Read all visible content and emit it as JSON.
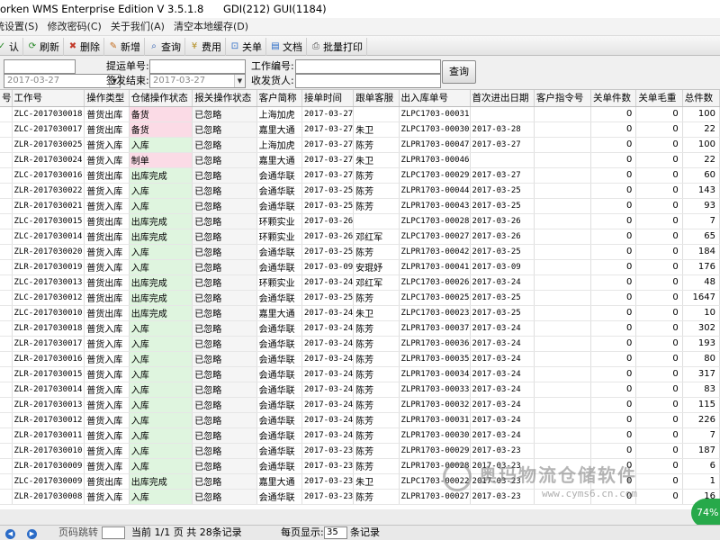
{
  "title": {
    "app": "orken WMS Enterprise Edition V 3.5.1.8",
    "gdi": "GDI(212) GUI(1184)"
  },
  "menu": [
    "统设置(S)",
    "修改密码(C)",
    "关于我们(A)",
    "清空本地缓存(D)"
  ],
  "toolbar": [
    {
      "label": "认",
      "icon": "check-icon"
    },
    {
      "label": "刷新",
      "icon": "refresh-icon"
    },
    {
      "label": "删除",
      "icon": "delete-icon"
    },
    {
      "label": "新增",
      "icon": "edit-icon"
    },
    {
      "label": "查询",
      "icon": "search-icon"
    },
    {
      "label": "费用",
      "icon": "money-icon"
    },
    {
      "label": "关单",
      "icon": "close-order-icon"
    },
    {
      "label": "文档",
      "icon": "document-icon"
    },
    {
      "label": "批量打印",
      "icon": "print-icon"
    }
  ],
  "filters": {
    "tracking_no_label": "提运单号:",
    "sign_end_label": "签发结束:",
    "work_no_label": "工作编号:",
    "consignee_label": "收发货人:",
    "start_date": "2017-03-27",
    "end_date": "2017-03-27",
    "query_button": "查询"
  },
  "columns": [
    "号",
    "工作号",
    "操作类型",
    "仓储操作状态",
    "报关操作状态",
    "客户简称",
    "接单时间",
    "跟单客服",
    "出入库单号",
    "首次进出日期",
    "客户指令号",
    "关单件数",
    "关单毛重",
    "总件数"
  ],
  "rows": [
    [
      "",
      "ZLC-2017030018",
      "普货出库",
      "备货",
      "已忽略",
      "上海加虎",
      "2017-03-27",
      "",
      "ZLPC1703-00031",
      "",
      "",
      "0",
      "0",
      "100"
    ],
    [
      "",
      "ZLC-2017030017",
      "普货出库",
      "备货",
      "已忽略",
      "嘉里大通",
      "2017-03-27",
      "朱卫",
      "ZLPC1703-00030",
      "2017-03-28",
      "",
      "0",
      "0",
      "22"
    ],
    [
      "",
      "ZLR-2017030025",
      "普货入库",
      "入库",
      "已忽略",
      "上海加虎",
      "2017-03-27",
      "陈芳",
      "ZLPR1703-00047",
      "2017-03-27",
      "",
      "0",
      "0",
      "100"
    ],
    [
      "",
      "ZLR-2017030024",
      "普货入库",
      "制单",
      "已忽略",
      "嘉里大通",
      "2017-03-27",
      "朱卫",
      "ZLPR1703-00046",
      "",
      "",
      "0",
      "0",
      "22"
    ],
    [
      "",
      "ZLC-2017030016",
      "普货出库",
      "出库完成",
      "已忽略",
      "会通华联",
      "2017-03-27",
      "陈芳",
      "ZLPC1703-00029",
      "2017-03-27",
      "",
      "0",
      "0",
      "60"
    ],
    [
      "",
      "ZLR-2017030022",
      "普货入库",
      "入库",
      "已忽略",
      "会通华联",
      "2017-03-25",
      "陈芳",
      "ZLPR1703-00044",
      "2017-03-25",
      "",
      "0",
      "0",
      "143"
    ],
    [
      "",
      "ZLR-2017030021",
      "普货入库",
      "入库",
      "已忽略",
      "会通华联",
      "2017-03-25",
      "陈芳",
      "ZLPR1703-00043",
      "2017-03-25",
      "",
      "0",
      "0",
      "93"
    ],
    [
      "",
      "ZLC-2017030015",
      "普货出库",
      "出库完成",
      "已忽略",
      "环颗实业",
      "2017-03-26",
      "",
      "ZLPC1703-00028",
      "2017-03-26",
      "",
      "0",
      "0",
      "7"
    ],
    [
      "",
      "ZLC-2017030014",
      "普货出库",
      "出库完成",
      "已忽略",
      "环颗实业",
      "2017-03-26",
      "邓红军",
      "ZLPC1703-00027",
      "2017-03-26",
      "",
      "0",
      "0",
      "65"
    ],
    [
      "",
      "ZLR-2017030020",
      "普货入库",
      "入库",
      "已忽略",
      "会通华联",
      "2017-03-25",
      "陈芳",
      "ZLPR1703-00042",
      "2017-03-25",
      "",
      "0",
      "0",
      "184"
    ],
    [
      "",
      "ZLR-2017030019",
      "普货入库",
      "入库",
      "已忽略",
      "会通华联",
      "2017-03-09",
      "安琨妤",
      "ZLPR1703-00041",
      "2017-03-09",
      "",
      "0",
      "0",
      "176"
    ],
    [
      "",
      "ZLC-2017030013",
      "普货出库",
      "出库完成",
      "已忽略",
      "环颗实业",
      "2017-03-24",
      "邓红军",
      "ZLPC1703-00026",
      "2017-03-24",
      "",
      "0",
      "0",
      "48"
    ],
    [
      "",
      "ZLC-2017030012",
      "普货出库",
      "出库完成",
      "已忽略",
      "会通华联",
      "2017-03-25",
      "陈芳",
      "ZLPC1703-00025",
      "2017-03-25",
      "",
      "0",
      "0",
      "1647"
    ],
    [
      "",
      "ZLC-2017030010",
      "普货出库",
      "出库完成",
      "已忽略",
      "嘉里大通",
      "2017-03-24",
      "朱卫",
      "ZLPC1703-00023",
      "2017-03-25",
      "",
      "0",
      "0",
      "10"
    ],
    [
      "",
      "ZLR-2017030018",
      "普货入库",
      "入库",
      "已忽略",
      "会通华联",
      "2017-03-24",
      "陈芳",
      "ZLPR1703-00037",
      "2017-03-24",
      "",
      "0",
      "0",
      "302"
    ],
    [
      "",
      "ZLR-2017030017",
      "普货入库",
      "入库",
      "已忽略",
      "会通华联",
      "2017-03-24",
      "陈芳",
      "ZLPR1703-00036",
      "2017-03-24",
      "",
      "0",
      "0",
      "193"
    ],
    [
      "",
      "ZLR-2017030016",
      "普货入库",
      "入库",
      "已忽略",
      "会通华联",
      "2017-03-24",
      "陈芳",
      "ZLPR1703-00035",
      "2017-03-24",
      "",
      "0",
      "0",
      "80"
    ],
    [
      "",
      "ZLR-2017030015",
      "普货入库",
      "入库",
      "已忽略",
      "会通华联",
      "2017-03-24",
      "陈芳",
      "ZLPR1703-00034",
      "2017-03-24",
      "",
      "0",
      "0",
      "317"
    ],
    [
      "",
      "ZLR-2017030014",
      "普货入库",
      "入库",
      "已忽略",
      "会通华联",
      "2017-03-24",
      "陈芳",
      "ZLPR1703-00033",
      "2017-03-24",
      "",
      "0",
      "0",
      "83"
    ],
    [
      "",
      "ZLR-2017030013",
      "普货入库",
      "入库",
      "已忽略",
      "会通华联",
      "2017-03-24",
      "陈芳",
      "ZLPR1703-00032",
      "2017-03-24",
      "",
      "0",
      "0",
      "115"
    ],
    [
      "",
      "ZLR-2017030012",
      "普货入库",
      "入库",
      "已忽略",
      "会通华联",
      "2017-03-24",
      "陈芳",
      "ZLPR1703-00031",
      "2017-03-24",
      "",
      "0",
      "0",
      "226"
    ],
    [
      "",
      "ZLR-2017030011",
      "普货入库",
      "入库",
      "已忽略",
      "会通华联",
      "2017-03-24",
      "陈芳",
      "ZLPR1703-00030",
      "2017-03-24",
      "",
      "0",
      "0",
      "7"
    ],
    [
      "",
      "ZLR-2017030010",
      "普货入库",
      "入库",
      "已忽略",
      "会通华联",
      "2017-03-23",
      "陈芳",
      "ZLPR1703-00029",
      "2017-03-23",
      "",
      "0",
      "0",
      "187"
    ],
    [
      "",
      "ZLR-2017030009",
      "普货入库",
      "入库",
      "已忽略",
      "会通华联",
      "2017-03-23",
      "陈芳",
      "ZLPR1703-00028",
      "2017-03-23",
      "",
      "0",
      "0",
      "6"
    ],
    [
      "",
      "ZLC-2017030009",
      "普货出库",
      "出库完成",
      "已忽略",
      "嘉里大通",
      "2017-03-23",
      "朱卫",
      "ZLPC1703-00022",
      "2017-03-23",
      "",
      "0",
      "0",
      "1"
    ],
    [
      "",
      "ZLR-2017030008",
      "普货入库",
      "入库",
      "已忽略",
      "会通华联",
      "2017-03-23",
      "陈芳",
      "ZLPR1703-00027",
      "2017-03-23",
      "",
      "0",
      "0",
      "16"
    ]
  ],
  "status_colors": {
    "入库": "#dff5df",
    "出库完成": "#dff5df",
    "备货": "#fbdbe6",
    "制单": "#fbdbe6"
  },
  "statusbar": {
    "page_jump_label": "页码跳转",
    "page_info": "当前 1/1 页 共 28条记录",
    "per_page_label": "每页显示:",
    "per_page_value": "35",
    "records_label": "条记录"
  },
  "badge": "74%",
  "watermark": {
    "text": "奥玛物流仓储软件",
    "url": "www.cyms6.cn.com"
  }
}
